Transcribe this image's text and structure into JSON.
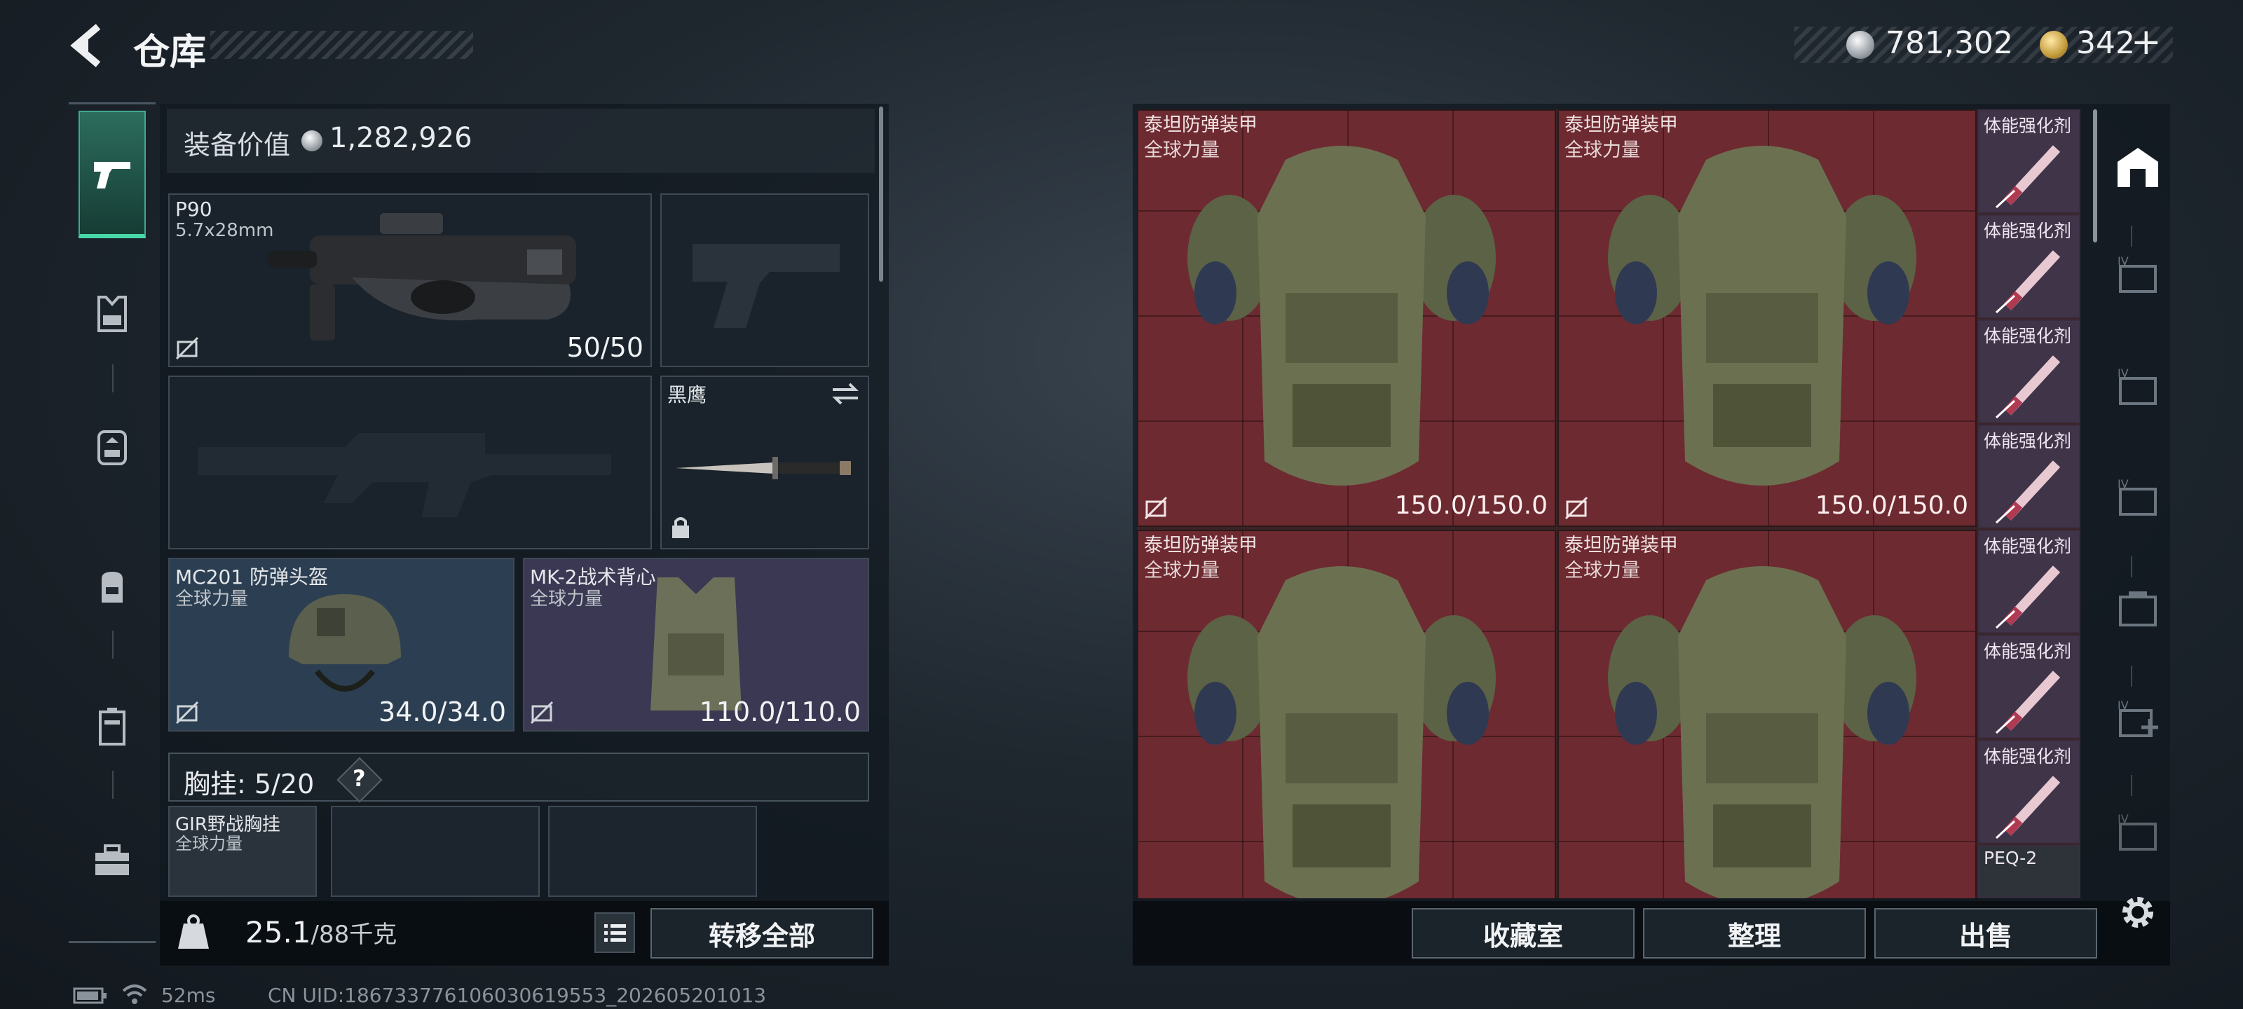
{
  "header": {
    "title": "仓库",
    "currency_silver": "781,302",
    "currency_gold": "342",
    "currency_plus": "+"
  },
  "sidebar_left": {
    "items": [
      "pistol-icon",
      "armor-vest-icon",
      "chest-rig-icon",
      "backpack-icon",
      "case-icon",
      "toolbox-icon"
    ],
    "active": 0
  },
  "equipment": {
    "value_label": "装备价值",
    "value": "1,282,926",
    "slots": {
      "primary": {
        "name": "P90",
        "caliber": "5.7x28mm",
        "ammo": "50/50"
      },
      "knife": {
        "name": "黑鹰"
      },
      "helmet": {
        "name": "MC201 防弹头盔",
        "faction": "全球力量",
        "durability": "34.0/34.0"
      },
      "vest": {
        "name": "MK-2战术背心",
        "faction": "全球力量",
        "durability": "110.0/110.0"
      }
    },
    "pouch": {
      "label": "胸挂:",
      "count": "5",
      "capacity": "/20",
      "help": "?"
    },
    "pouch_item": {
      "name": "GIR野战胸挂",
      "faction": "全球力量"
    }
  },
  "left_bottom": {
    "weight": "25.1",
    "weight_max": "/88千克",
    "transfer_all": "转移全部"
  },
  "stash": {
    "armors": [
      {
        "name": "泰坦防弹装甲",
        "faction": "全球力量",
        "durability": "150.0/150.0"
      },
      {
        "name": "泰坦防弹装甲",
        "faction": "全球力量",
        "durability": "150.0/150.0"
      },
      {
        "name": "泰坦防弹装甲",
        "faction": "全球力量",
        "durability": ""
      },
      {
        "name": "泰坦防弹装甲",
        "faction": "全球力量",
        "durability": ""
      }
    ],
    "small_items": [
      "体能强化剂",
      "体能强化剂",
      "体能强化剂",
      "体能强化剂",
      "体能强化剂",
      "体能强化剂",
      "体能强化剂",
      "PEQ-2"
    ]
  },
  "right_bottom": {
    "collection": "收藏室",
    "sort": "整理",
    "sell": "出售"
  },
  "footer": {
    "ping": "52ms",
    "uid": "CN UID:18673377610603061955​3_202605201013"
  },
  "colors": {
    "accent_green": "#47d7a8",
    "armor_cell": "#6e2a31",
    "consumable_cell": "#403449",
    "helmet_slot": "#2c3f52",
    "vest_slot": "#3a3852"
  }
}
